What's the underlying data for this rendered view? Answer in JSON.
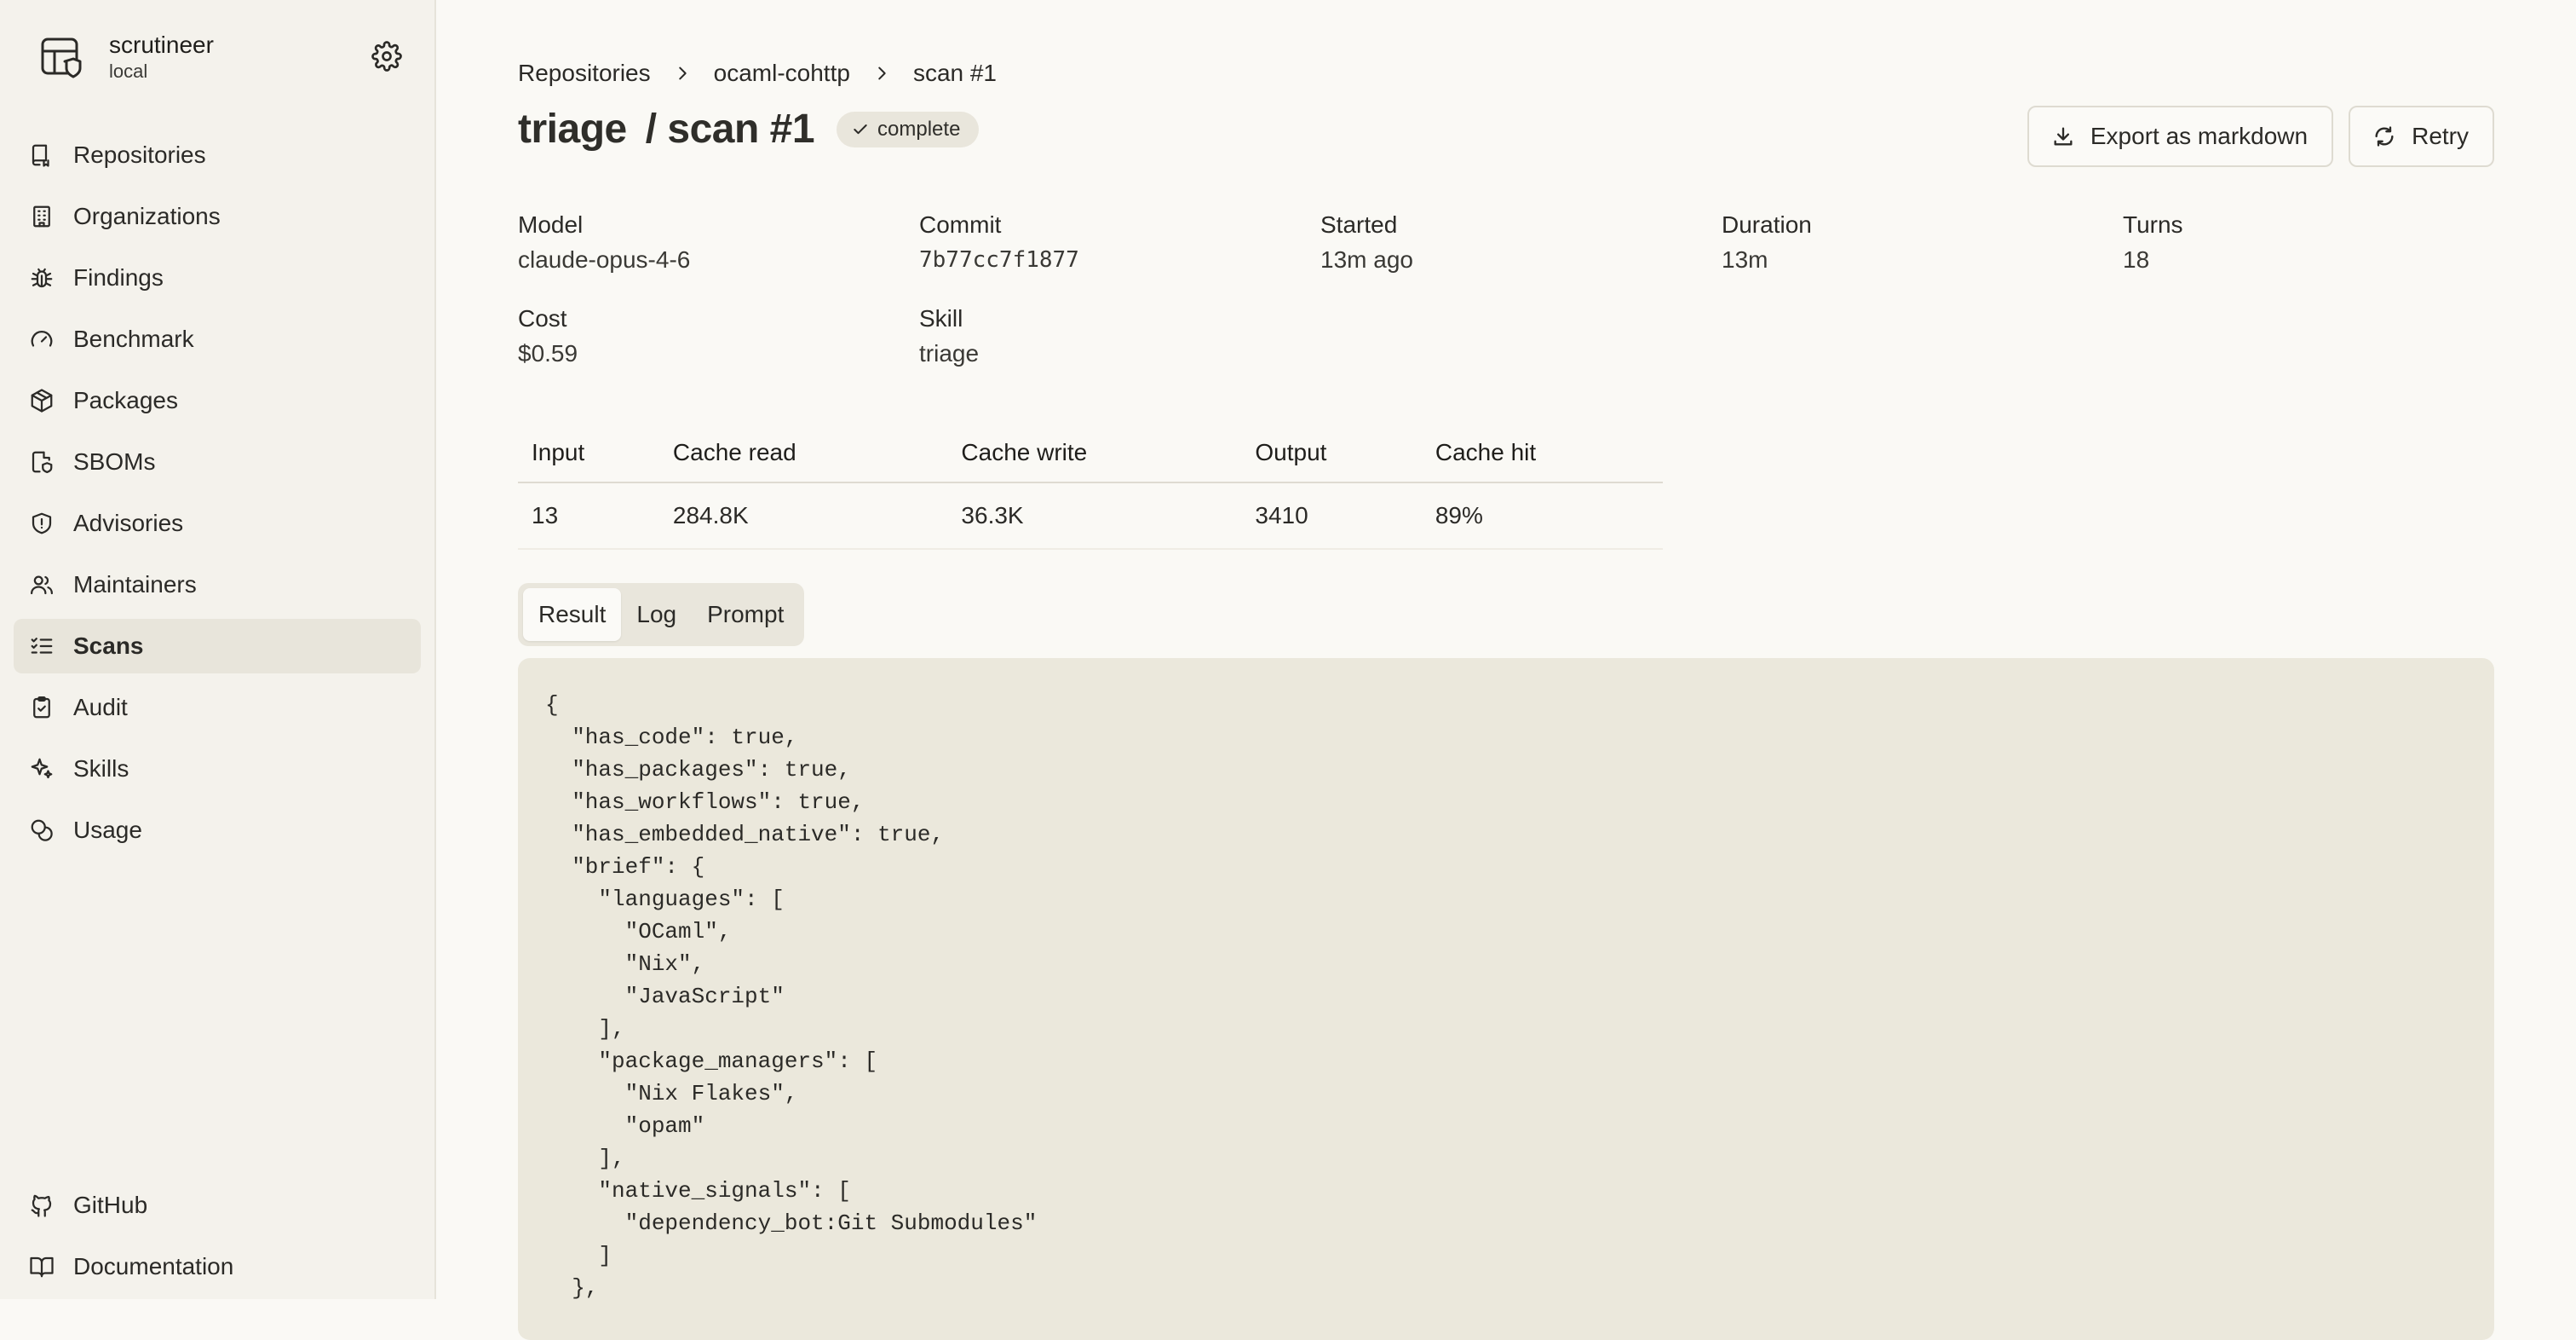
{
  "brand": {
    "name": "scrutineer",
    "env": "local"
  },
  "nav": {
    "items": [
      {
        "label": "Repositories",
        "icon": "repo-icon"
      },
      {
        "label": "Organizations",
        "icon": "building-icon"
      },
      {
        "label": "Findings",
        "icon": "bug-icon"
      },
      {
        "label": "Benchmark",
        "icon": "gauge-icon"
      },
      {
        "label": "Packages",
        "icon": "package-icon"
      },
      {
        "label": "SBOMs",
        "icon": "file-shield-icon"
      },
      {
        "label": "Advisories",
        "icon": "shield-icon"
      },
      {
        "label": "Maintainers",
        "icon": "users-icon"
      },
      {
        "label": "Scans",
        "icon": "checklist-icon",
        "active": true
      },
      {
        "label": "Audit",
        "icon": "clipboard-check-icon"
      },
      {
        "label": "Skills",
        "icon": "sparkles-icon"
      },
      {
        "label": "Usage",
        "icon": "coins-icon"
      }
    ],
    "bottom": [
      {
        "label": "GitHub",
        "icon": "github-icon"
      },
      {
        "label": "Documentation",
        "icon": "book-icon"
      }
    ]
  },
  "breadcrumb": [
    "Repositories",
    "ocaml-cohttp",
    "scan #1"
  ],
  "header": {
    "title_skill": "triage",
    "title_scan": "/ scan #1",
    "status": "complete",
    "export_label": "Export as markdown",
    "retry_label": "Retry"
  },
  "meta": [
    {
      "label": "Model",
      "value": "claude-opus-4-6"
    },
    {
      "label": "Commit",
      "value": "7b77cc7f1877"
    },
    {
      "label": "Started",
      "value": "13m ago"
    },
    {
      "label": "Duration",
      "value": "13m"
    },
    {
      "label": "Turns",
      "value": "18"
    },
    {
      "label": "Cost",
      "value": "$0.59"
    },
    {
      "label": "Skill",
      "value": "triage"
    }
  ],
  "usage": {
    "headers": [
      "Input",
      "Cache read",
      "Cache write",
      "Output",
      "Cache hit"
    ],
    "row": [
      "13",
      "284.8K",
      "36.3K",
      "3410",
      "89%"
    ]
  },
  "tabs": [
    "Result",
    "Log",
    "Prompt"
  ],
  "result_json": "{\n  \"has_code\": true,\n  \"has_packages\": true,\n  \"has_workflows\": true,\n  \"has_embedded_native\": true,\n  \"brief\": {\n    \"languages\": [\n      \"OCaml\",\n      \"Nix\",\n      \"JavaScript\"\n    ],\n    \"package_managers\": [\n      \"Nix Flakes\",\n      \"opam\"\n    ],\n    \"native_signals\": [\n      \"dependency_bot:Git Submodules\"\n    ]\n  },"
}
